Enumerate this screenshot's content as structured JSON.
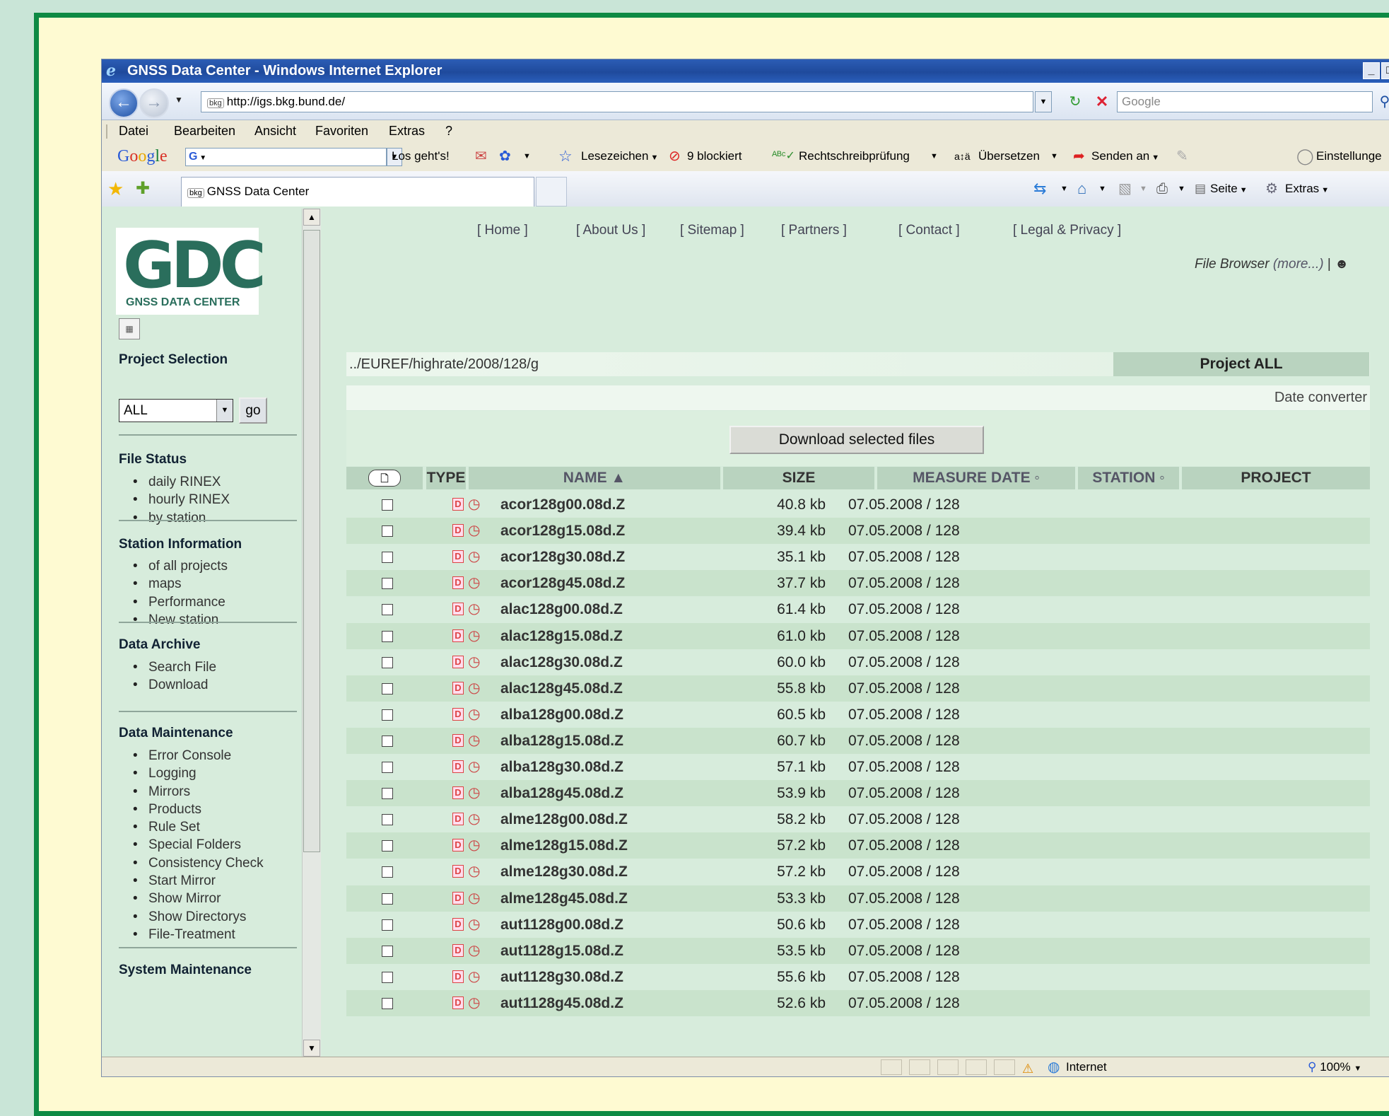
{
  "window": {
    "title": "GNSS Data Center - Windows Internet Explorer",
    "buttons": [
      "_",
      "□"
    ]
  },
  "address": {
    "url": "http://igs.bkg.bund.de/",
    "favicon": "bkg",
    "search_placeholder": "Google"
  },
  "menu": [
    "Datei",
    "Bearbeiten",
    "Ansicht",
    "Favoriten",
    "Extras",
    "?"
  ],
  "google_toolbar": {
    "logo": [
      "G",
      "o",
      "o",
      "g",
      "l",
      "e"
    ],
    "box": "G",
    "go": "Los geht's!",
    "bookmarks": "Lesezeichen",
    "blocked": "9 blockiert",
    "spell": "Rechtschreibprüfung",
    "translate": "Übersetzen",
    "send": "Senden an",
    "settings": "Einstellunge"
  },
  "tabbar": {
    "tab_favicon": "bkg",
    "tab_title": "GNSS Data Center",
    "page_label": "Seite",
    "extras_label": "Extras"
  },
  "sidebar": {
    "logo_big": "GDC",
    "logo_small": "GNSS DATA CENTER",
    "project_selection": {
      "heading": "Project Selection",
      "value": "ALL",
      "go": "go"
    },
    "sections": [
      {
        "heading": "File Status",
        "items": [
          "daily RINEX",
          "hourly RINEX",
          "by station"
        ]
      },
      {
        "heading": "Station Information",
        "items": [
          "of all projects",
          "maps",
          "Performance",
          "New station"
        ]
      },
      {
        "heading": "Data Archive",
        "items": [
          "Search File",
          "Download"
        ]
      },
      {
        "heading": "Data Maintenance",
        "items": [
          "Error Console",
          "Logging",
          "Mirrors",
          "Products",
          "Rule Set",
          "Special Folders",
          "Consistency Check",
          "Start Mirror",
          "Show Mirror",
          "Show Directorys",
          "File-Treatment"
        ]
      },
      {
        "heading": "System Maintenance",
        "items": []
      }
    ]
  },
  "main": {
    "nav": [
      "[ Home ]",
      "[ About Us ]",
      "[ Sitemap ]",
      "[ Partners ]",
      "[ Contact ]",
      "[ Legal & Privacy ]"
    ],
    "file_browser": "File Browser",
    "file_browser_more": "(more...)",
    "file_browser_sep": "|",
    "path": "../EUREF/highrate/2008/128/g",
    "project": "Project ALL",
    "date_converter": "Date converter",
    "download_button": "Download selected files",
    "columns": {
      "type": "TYPE",
      "name": "NAME ▲",
      "size": "SIZE",
      "date": "MEASURE DATE ◦",
      "station": "STATION ◦",
      "project": "PROJECT"
    },
    "rows": [
      {
        "name": "acor128g00.08d.Z",
        "size": "40.8 kb",
        "date": "07.05.2008 / 128"
      },
      {
        "name": "acor128g15.08d.Z",
        "size": "39.4 kb",
        "date": "07.05.2008 / 128"
      },
      {
        "name": "acor128g30.08d.Z",
        "size": "35.1 kb",
        "date": "07.05.2008 / 128"
      },
      {
        "name": "acor128g45.08d.Z",
        "size": "37.7 kb",
        "date": "07.05.2008 / 128"
      },
      {
        "name": "alac128g00.08d.Z",
        "size": "61.4 kb",
        "date": "07.05.2008 / 128"
      },
      {
        "name": "alac128g15.08d.Z",
        "size": "61.0 kb",
        "date": "07.05.2008 / 128"
      },
      {
        "name": "alac128g30.08d.Z",
        "size": "60.0 kb",
        "date": "07.05.2008 / 128"
      },
      {
        "name": "alac128g45.08d.Z",
        "size": "55.8 kb",
        "date": "07.05.2008 / 128"
      },
      {
        "name": "alba128g00.08d.Z",
        "size": "60.5 kb",
        "date": "07.05.2008 / 128"
      },
      {
        "name": "alba128g15.08d.Z",
        "size": "60.7 kb",
        "date": "07.05.2008 / 128"
      },
      {
        "name": "alba128g30.08d.Z",
        "size": "57.1 kb",
        "date": "07.05.2008 / 128"
      },
      {
        "name": "alba128g45.08d.Z",
        "size": "53.9 kb",
        "date": "07.05.2008 / 128"
      },
      {
        "name": "alme128g00.08d.Z",
        "size": "58.2 kb",
        "date": "07.05.2008 / 128"
      },
      {
        "name": "alme128g15.08d.Z",
        "size": "57.2 kb",
        "date": "07.05.2008 / 128"
      },
      {
        "name": "alme128g30.08d.Z",
        "size": "57.2 kb",
        "date": "07.05.2008 / 128"
      },
      {
        "name": "alme128g45.08d.Z",
        "size": "53.3 kb",
        "date": "07.05.2008 / 128"
      },
      {
        "name": "aut1128g00.08d.Z",
        "size": "50.6 kb",
        "date": "07.05.2008 / 128"
      },
      {
        "name": "aut1128g15.08d.Z",
        "size": "53.5 kb",
        "date": "07.05.2008 / 128"
      },
      {
        "name": "aut1128g30.08d.Z",
        "size": "55.6 kb",
        "date": "07.05.2008 / 128"
      },
      {
        "name": "aut1128g45.08d.Z",
        "size": "52.6 kb",
        "date": "07.05.2008 / 128"
      }
    ]
  },
  "status": {
    "zone": "Internet",
    "zoom": "100%"
  }
}
